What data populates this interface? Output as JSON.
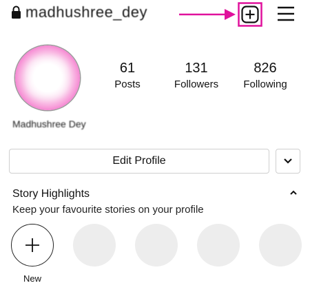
{
  "header": {
    "username": "madhushree_dey",
    "icons": [
      "lock-icon",
      "arrow-icon",
      "plus-square-icon",
      "menu-icon"
    ],
    "accent_color": "#e0119c"
  },
  "profile": {
    "display_name": "Madhushree Dey",
    "avatar_colors": [
      "#ffffff",
      "#ef58c5"
    ]
  },
  "stats": {
    "posts": {
      "value": "61",
      "label": "Posts"
    },
    "followers": {
      "value": "131",
      "label": "Followers"
    },
    "following": {
      "value": "826",
      "label": "Following"
    }
  },
  "actions": {
    "edit_profile_label": "Edit Profile",
    "more_icon": "chevron-down-icon"
  },
  "highlights": {
    "title": "Story Highlights",
    "subtitle": "Keep your favourite stories on your profile",
    "collapse_icon": "chevron-up-icon",
    "new_label": "New",
    "placeholder_count": 4
  }
}
